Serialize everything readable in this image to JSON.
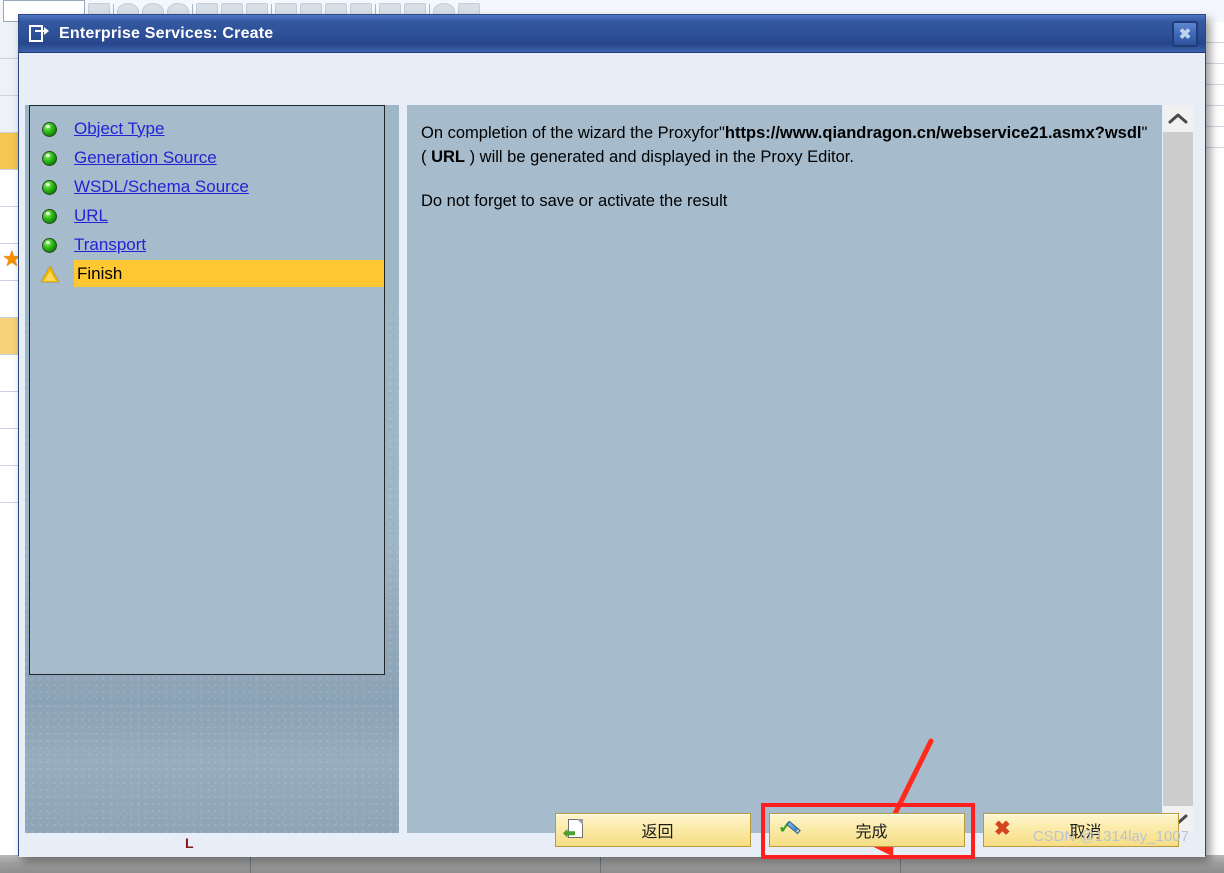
{
  "window": {
    "title": "Enterprise Services: Create",
    "title_icon": "create-object-icon",
    "close_label": "✖",
    "close_icon": "close-icon",
    "accent_titlebar": "#2e5099",
    "accent_highlight": "#ffc832",
    "accent_annotation": "#ff1f1f"
  },
  "wizard": {
    "steps": [
      {
        "label": "Object Type",
        "status": "done",
        "icon": "green-led-icon"
      },
      {
        "label": "Generation Source",
        "status": "done",
        "icon": "green-led-icon"
      },
      {
        "label": "WSDL/Schema Source",
        "status": "done",
        "icon": "green-led-icon"
      },
      {
        "label": "URL",
        "status": "done",
        "icon": "green-led-icon"
      },
      {
        "label": "Transport",
        "status": "done",
        "icon": "green-led-icon"
      },
      {
        "label": "Finish",
        "status": "current",
        "icon": "warning-triangle-icon"
      }
    ]
  },
  "content": {
    "para1_a": "On completion of the wizard the Proxyfor\"",
    "para1_url": "https://www.qiandragon.cn/webservice21.asmx?wsdl",
    "para1_b": "\" ( ",
    "para1_kind": "URL",
    "para1_c": " ) will be generated and displayed in the Proxy Editor.",
    "para2": "Do not forget to save or activate the result"
  },
  "scrollbar": {
    "up_icon": "chevron-up-icon",
    "down_icon": "chevron-down-icon"
  },
  "buttons": {
    "back": {
      "label": "返回",
      "icon": "page-back-icon"
    },
    "finish": {
      "label": "完成",
      "icon": "check-pencil-icon",
      "highlighted": true
    },
    "cancel": {
      "label": "取消",
      "icon": "red-x-icon"
    }
  },
  "marks": {
    "corner_mark": "L",
    "watermark": "CSDN @1314lay_1007"
  }
}
